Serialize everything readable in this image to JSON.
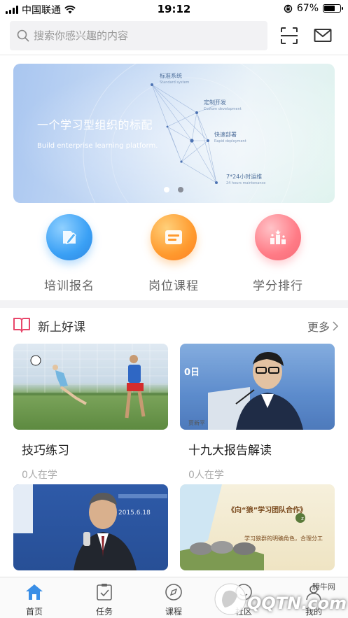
{
  "status_bar": {
    "carrier": "中国联通",
    "time": "19:12",
    "battery": "67%",
    "battery_level": 0.67
  },
  "header": {
    "search_placeholder": "搜索你感兴趣的内容",
    "icons": [
      "search-icon",
      "scan-icon",
      "message-icon"
    ]
  },
  "banner": {
    "title": "一个学习型组织的标配",
    "subtitle": "Build enterprise learning platform.",
    "nodes": [
      {
        "label": "标准系统",
        "sub": "Standard system"
      },
      {
        "label": "定制开发",
        "sub": "Custom development"
      },
      {
        "label": "快速部署",
        "sub": "Rapid deployment"
      },
      {
        "label": "7*24小时运维",
        "sub": "24 hours maintenance"
      }
    ],
    "pages": 2,
    "active_page": 2
  },
  "quick_entries": [
    {
      "label": "培训报名",
      "icon": "edit-icon",
      "color": "#3aa0f5"
    },
    {
      "label": "岗位课程",
      "icon": "card-icon",
      "color": "#ff9a2e"
    },
    {
      "label": "学分排行",
      "icon": "ranking-icon",
      "color": "#ff7b86"
    }
  ],
  "section": {
    "title": "新上好课",
    "more": "更多",
    "icon": "book-icon",
    "accent": "#e8466a"
  },
  "courses": [
    {
      "title": "技巧练习",
      "count": "0人在学",
      "thumb": "soccer-photo"
    },
    {
      "title": "十九大报告解读",
      "count": "0人在学",
      "thumb": "speaker-photo",
      "thumb_text": "0日",
      "thumb_caption": "贾新平"
    },
    {
      "title": "",
      "count": "",
      "thumb": "lecturer-photo",
      "thumb_text": "2015.6.18"
    },
    {
      "title": "",
      "count": "",
      "thumb": "wolf-team-slide",
      "thumb_text": "《向“狼”学习团队合作》",
      "thumb_caption": "学习狼群的明确角色，合理分工"
    }
  ],
  "tabbar": {
    "items": [
      {
        "label": "首页",
        "icon": "home-icon",
        "active": true
      },
      {
        "label": "任务",
        "icon": "task-icon",
        "active": false
      },
      {
        "label": "课程",
        "icon": "compass-icon",
        "active": false
      },
      {
        "label": "社区",
        "icon": "community-icon",
        "active": false
      },
      {
        "label": "我的",
        "icon": "profile-icon",
        "active": false
      }
    ]
  },
  "watermark": {
    "site": "腾牛网",
    "logo": "QQTN.com"
  },
  "colors": {
    "primary": "#3a8ee6",
    "section_accent": "#e8466a"
  }
}
